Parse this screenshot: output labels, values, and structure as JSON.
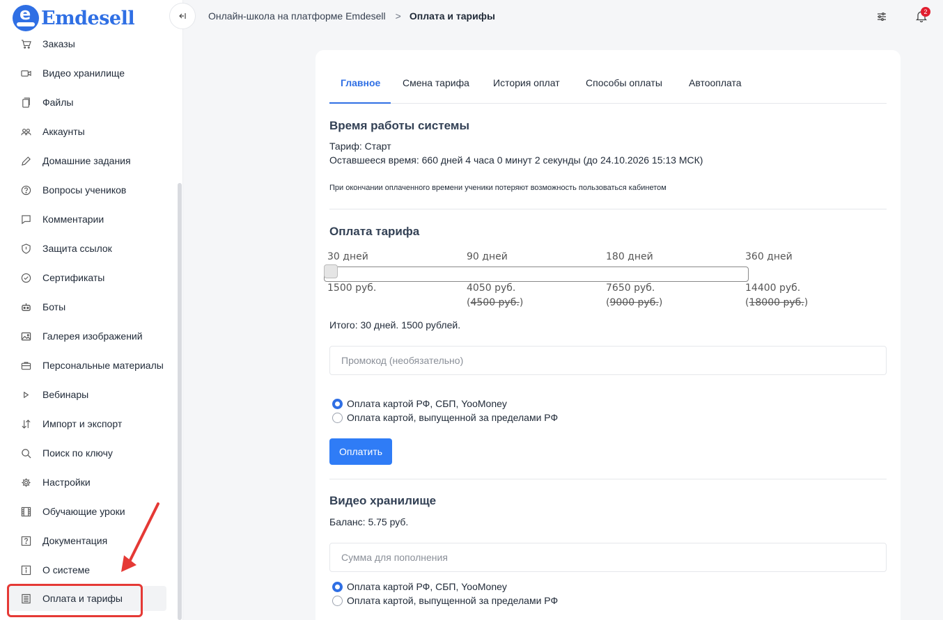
{
  "app": {
    "logo_text": "Emdesell",
    "logo_letter": "e"
  },
  "sidebar": {
    "items": [
      {
        "label": "Заказы",
        "icon": "cart-icon"
      },
      {
        "label": "Видео хранилище",
        "icon": "video-icon"
      },
      {
        "label": "Файлы",
        "icon": "files-icon"
      },
      {
        "label": "Аккаунты",
        "icon": "users-icon"
      },
      {
        "label": "Домашние задания",
        "icon": "pencil-icon"
      },
      {
        "label": "Вопросы учеников",
        "icon": "question-icon"
      },
      {
        "label": "Комментарии",
        "icon": "comment-icon"
      },
      {
        "label": "Защита ссылок",
        "icon": "shield-icon"
      },
      {
        "label": "Сертификаты",
        "icon": "check-circle-icon"
      },
      {
        "label": "Боты",
        "icon": "bot-icon"
      },
      {
        "label": "Галерея изображений",
        "icon": "image-icon"
      },
      {
        "label": "Персональные материалы",
        "icon": "briefcase-icon"
      },
      {
        "label": "Вебинары",
        "icon": "play-icon"
      },
      {
        "label": "Импорт и экспорт",
        "icon": "import-export-icon"
      },
      {
        "label": "Поиск по ключу",
        "icon": "search-icon"
      },
      {
        "label": "Настройки",
        "icon": "gear-icon"
      },
      {
        "label": "Обучающие уроки",
        "icon": "film-icon"
      },
      {
        "label": "Документация",
        "icon": "help-doc-icon"
      },
      {
        "label": "О системе",
        "icon": "info-icon"
      },
      {
        "label": "Оплата и тарифы",
        "icon": "receipt-icon",
        "active": true
      }
    ]
  },
  "header": {
    "breadcrumb_root": "Онлайн-школа на платформе Emdesell",
    "breadcrumb_sep": ">",
    "breadcrumb_current": "Оплата и тарифы",
    "notifications_count": "2"
  },
  "tabs": [
    "Главное",
    "Смена тарифа",
    "История оплат",
    "Способы оплаты",
    "Автооплата"
  ],
  "system": {
    "title": "Время работы системы",
    "tariff": "Тариф: Старт",
    "remaining": "Оставшееся время: 660 дней 4 часа 0 минут 2 секунды (до 24.10.2026 15:13 МСК)",
    "note": "При окончании оплаченного времени ученики потеряют возможность пользоваться кабинетом"
  },
  "tariff_payment": {
    "title": "Оплата тарифа",
    "periods": [
      {
        "label": "30 дней",
        "price": "1500 руб.",
        "old_price": ""
      },
      {
        "label": "90 дней",
        "price": "4050 руб.",
        "old_price": "4500 руб."
      },
      {
        "label": "180 дней",
        "price": "7650 руб.",
        "old_price": "9000 руб."
      },
      {
        "label": "360 дней",
        "price": "14400 руб.",
        "old_price": "18000 руб."
      }
    ],
    "slider_position": 0,
    "total": "Итого: 30 дней. 1500 рублей.",
    "promo_placeholder": "Промокод (необязательно)",
    "methods": [
      "Оплата картой РФ, СБП, YooMoney",
      "Оплата картой, выпущенной за пределами РФ"
    ],
    "pay_button": "Оплатить"
  },
  "video_storage": {
    "title": "Видео хранилище",
    "balance": "Баланс: 5.75 руб.",
    "amount_placeholder": "Сумма для пополнения",
    "methods": [
      "Оплата картой РФ, СБП, YooMoney",
      "Оплата картой, выпущенной за пределами РФ"
    ]
  },
  "colors": {
    "accent": "#2f6fe4",
    "annotation": "#e53935"
  }
}
